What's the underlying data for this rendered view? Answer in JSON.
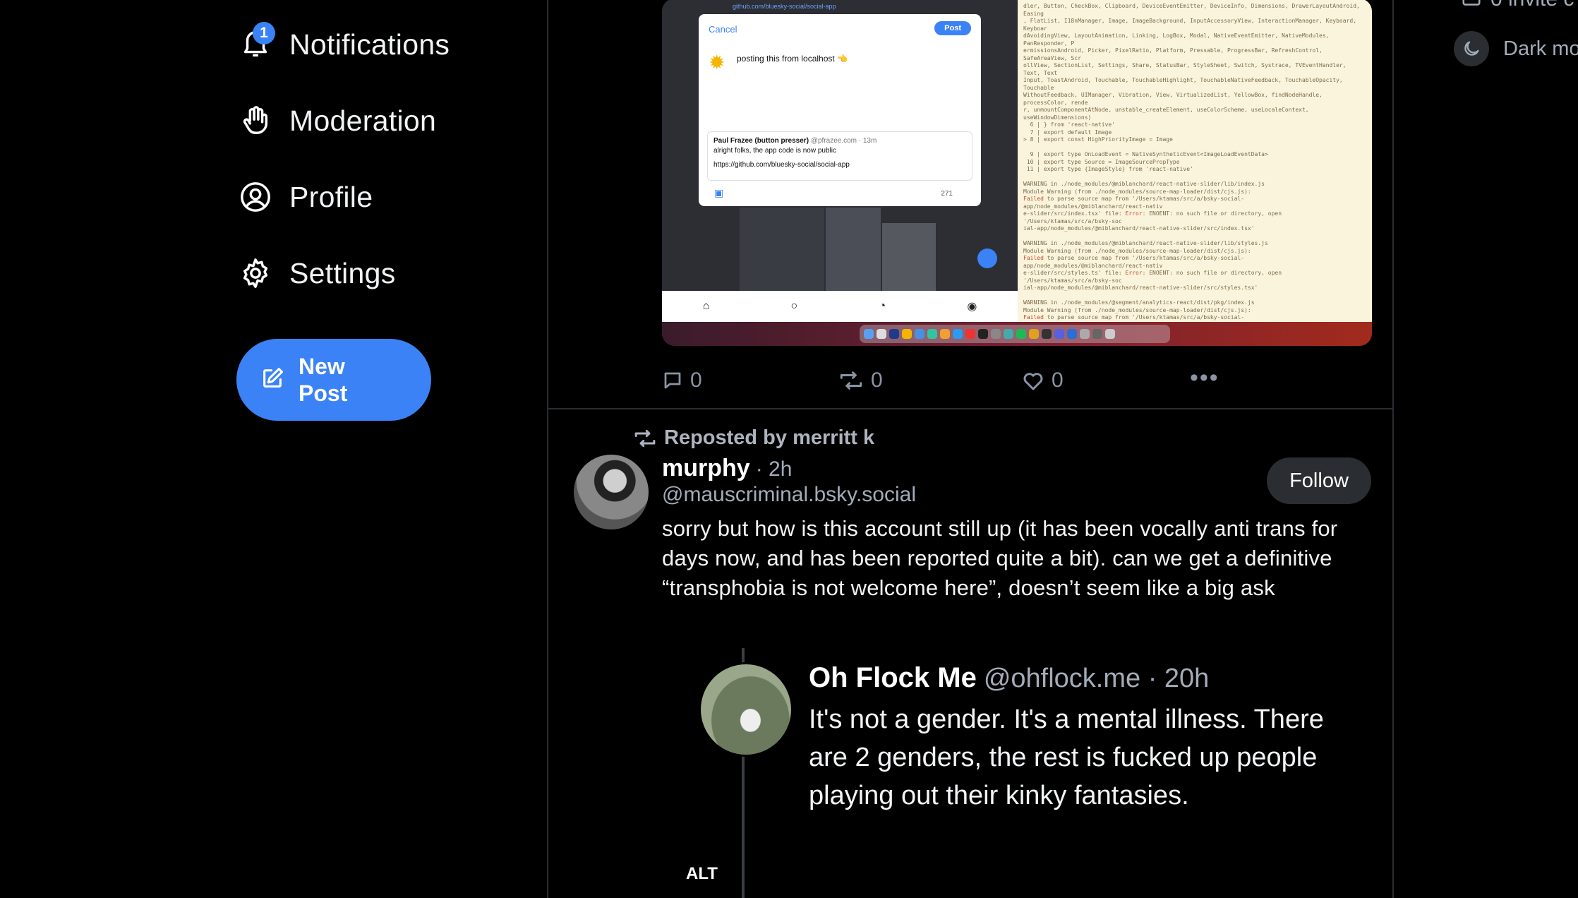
{
  "sidebar": {
    "items": [
      {
        "label": "Notifications",
        "badge": "1",
        "icon": "bell-icon"
      },
      {
        "label": "Moderation",
        "icon": "hand-icon"
      },
      {
        "label": "Profile",
        "icon": "user-circle-icon"
      },
      {
        "label": "Settings",
        "icon": "gear-icon"
      }
    ],
    "new_post_label": "New Post"
  },
  "post1": {
    "screenshot": {
      "compose_cancel": "Cancel",
      "compose_post": "Post",
      "compose_text": "posting this from localhost 👈",
      "quote_author": "Paul Frazee (button presser)",
      "quote_handle": "@pfrazee.com · 13m",
      "quote_text": "alright folks, the app code is now public",
      "quote_link": "https://github.com/bluesky-social/social-app",
      "char_count": "271",
      "top_link": "github.com/bluesky-social/social-app"
    },
    "replies": "0",
    "reposts": "0",
    "likes": "0"
  },
  "post2": {
    "repost_by": "Reposted by merritt k",
    "author": "murphy",
    "time": "· 2h",
    "handle": "@mauscriminal.bsky.social",
    "follow_label": "Follow",
    "text": "sorry but how is this account still up (it has been vocally anti trans for days now, and has been reported quite a bit). can we get a definitive “transphobia is not welcome here”, doesn’t seem like a big ask",
    "embed": {
      "author": "Oh Flock Me",
      "handle_time": "@ohflock.me · 20h",
      "text": "It's not a gender. It's a mental illness. There are 2 genders, the rest is fucked up people playing out their kinky fantasies.",
      "alt_label": "ALT"
    }
  },
  "right": {
    "invite_label": "0 invite c",
    "dark_mode_label": "Dark mo"
  },
  "colors": {
    "accent": "#3b82f6",
    "background": "#000000",
    "muted_text": "#a3acb8",
    "border": "#2a2d31"
  }
}
